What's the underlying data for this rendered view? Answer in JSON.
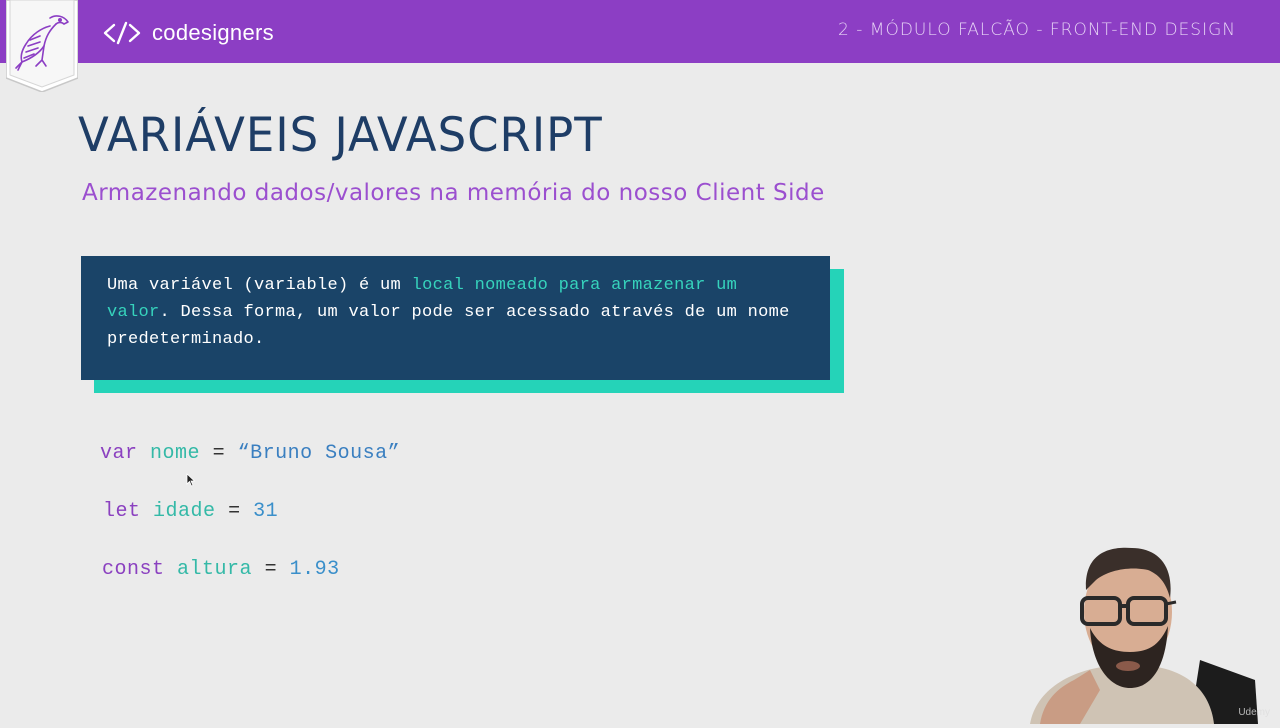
{
  "header": {
    "brand_name": "codesigners",
    "module_title": "2 - MÓDULO FALCÃO - FRONT-END DESIGN"
  },
  "slide": {
    "title": "VARIÁVEIS JAVASCRIPT",
    "subtitle": "Armazenando dados/valores na memória do nosso Client Side",
    "callout": {
      "text_before": "Uma variável (variable) é um ",
      "highlight": "local nomeado para armazenar um valor",
      "text_after": ". Dessa forma, um valor pode ser acessado através de um nome predeterminado."
    },
    "code_lines": [
      {
        "keyword": "var",
        "name": "nome",
        "operator": "=",
        "value": "“Bruno Sousa”"
      },
      {
        "keyword": "let",
        "name": "idade",
        "operator": "=",
        "value": "31"
      },
      {
        "keyword": "const",
        "name": "altura",
        "operator": "=",
        "value": "1.93"
      }
    ]
  },
  "overlay": {
    "watermark": "Udemy"
  },
  "colors": {
    "header_bg": "#8c3ec4",
    "title": "#1e3d66",
    "subtitle": "#9b4fcf",
    "callout_bg": "#1a4468",
    "callout_accent": "#25d3b8",
    "keyword": "#8b41c0",
    "identifier": "#34b9a7",
    "value": "#3a7fc0"
  },
  "icons": [
    "falcon-logo-icon",
    "code-brackets-icon",
    "mouse-cursor-icon"
  ]
}
